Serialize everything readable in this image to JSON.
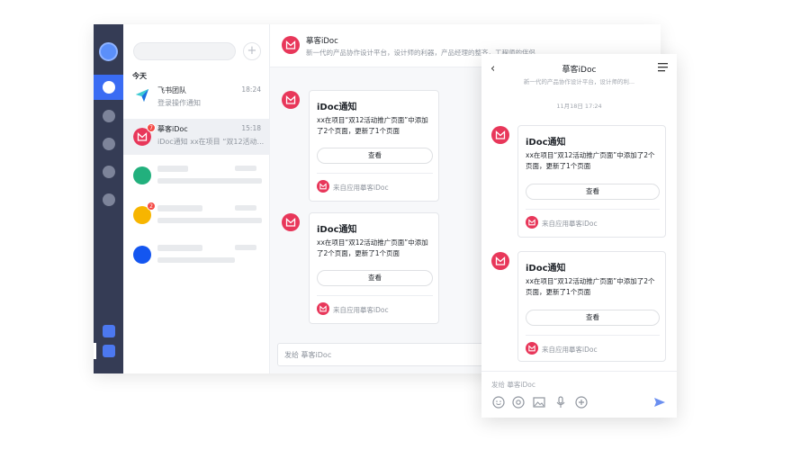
{
  "colors": {
    "brand": "#e8375a",
    "rail": "#353c55",
    "accent": "#3a6cf3"
  },
  "desktop": {
    "rail": {
      "icons": [
        "avatar-icon",
        "chat-icon",
        "circle-icon",
        "circle-icon",
        "circle-icon",
        "circle-icon",
        "app-icon",
        "app-icon"
      ]
    },
    "search": {
      "placeholder": ""
    },
    "list": {
      "section": "今天",
      "items": [
        {
          "name": "飞书团队",
          "time": "18:24",
          "preview": "登录操作通知",
          "icon": "paper-plane-icon"
        },
        {
          "name": "摹客iDoc",
          "time": "15:18",
          "preview": "iDoc通知 xx在项目 “双12活动...",
          "badge": "7",
          "icon": "idoc-logo-icon"
        }
      ],
      "blurred_badge": "2"
    },
    "header": {
      "name": "摹客iDoc",
      "subtitle": "新一代的产品协作设计平台，设计师的利器，产品经理的整齐，工程师的伴侣"
    },
    "messages": [
      {
        "title": "iDoc通知",
        "text": "xx在项目“双12活动推广页面”中添加了2个页面，更新了1个页面",
        "button": "查看",
        "source": "来自应用摹客iDoc"
      },
      {
        "title": "iDoc通知",
        "text": "xx在项目“双12活动推广页面”中添加了2个页面，更新了1个页面",
        "button": "查看",
        "source": "来自应用摹客iDoc"
      }
    ],
    "input_placeholder": "发给 摹客iDoc"
  },
  "phone": {
    "title": "摹客iDoc",
    "subtitle": "新一代的产品协作设计平台，设计师的利...",
    "date": "11月18日  17:24",
    "messages": [
      {
        "title": "iDoc通知",
        "text": "xx在项目“双12活动推广页面”中添加了2个页面，更新了1个页面",
        "button": "查看",
        "source": "来自应用摹客iDoc"
      },
      {
        "title": "iDoc通知",
        "text": "xx在项目“双12活动推广页面”中添加了2个页面，更新了1个页面",
        "button": "查看",
        "source": "来自应用摹客iDoc"
      }
    ],
    "input_placeholder": "发给 摹客iDoc",
    "tools": [
      "emoji-icon",
      "at-icon",
      "image-icon",
      "microphone-icon",
      "plus-circle-icon",
      "send-icon"
    ]
  }
}
